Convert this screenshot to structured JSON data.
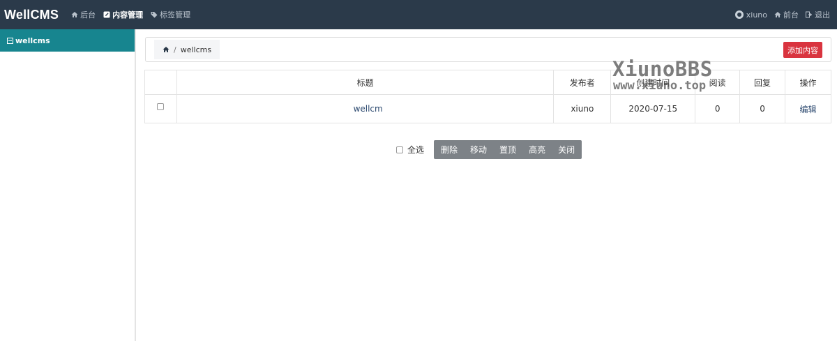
{
  "header": {
    "brand": "WellCMS",
    "nav": [
      {
        "label": "后台",
        "icon": "home-icon"
      },
      {
        "label": "内容管理",
        "icon": "edit-icon",
        "active": true
      },
      {
        "label": "标签管理",
        "icon": "tag-icon"
      }
    ],
    "user": {
      "name": "xiuno",
      "icon": "avatar-icon"
    },
    "right_nav": [
      {
        "label": "前台",
        "icon": "home-icon"
      },
      {
        "label": "退出",
        "icon": "logout-icon"
      }
    ]
  },
  "sidebar": {
    "items": [
      {
        "label": "wellcms",
        "icon": "minus-square-icon",
        "active": true
      }
    ]
  },
  "breadcrumb": {
    "items": [
      "wellcms"
    ]
  },
  "add_button": "添加内容",
  "table": {
    "columns": [
      "",
      "标题",
      "发布者",
      "创建时间",
      "阅读",
      "回复",
      "操作"
    ],
    "rows": [
      {
        "title": "wellcm",
        "author": "xiuno",
        "created": "2020-07-15",
        "views": "0",
        "replies": "0",
        "action": "编辑"
      }
    ]
  },
  "watermark": {
    "line1": "XiunoBBS",
    "line2": "www.xiuno.top"
  },
  "bulk_actions": {
    "select_all": "全选",
    "buttons": [
      "删除",
      "移动",
      "置顶",
      "高亮",
      "关闭"
    ]
  },
  "colors": {
    "topbar": "#2b3a4a",
    "sidebar_active": "#17858f",
    "add_button": "#d9343f",
    "button_group": "#7d8287",
    "link": "#2d4a70"
  }
}
